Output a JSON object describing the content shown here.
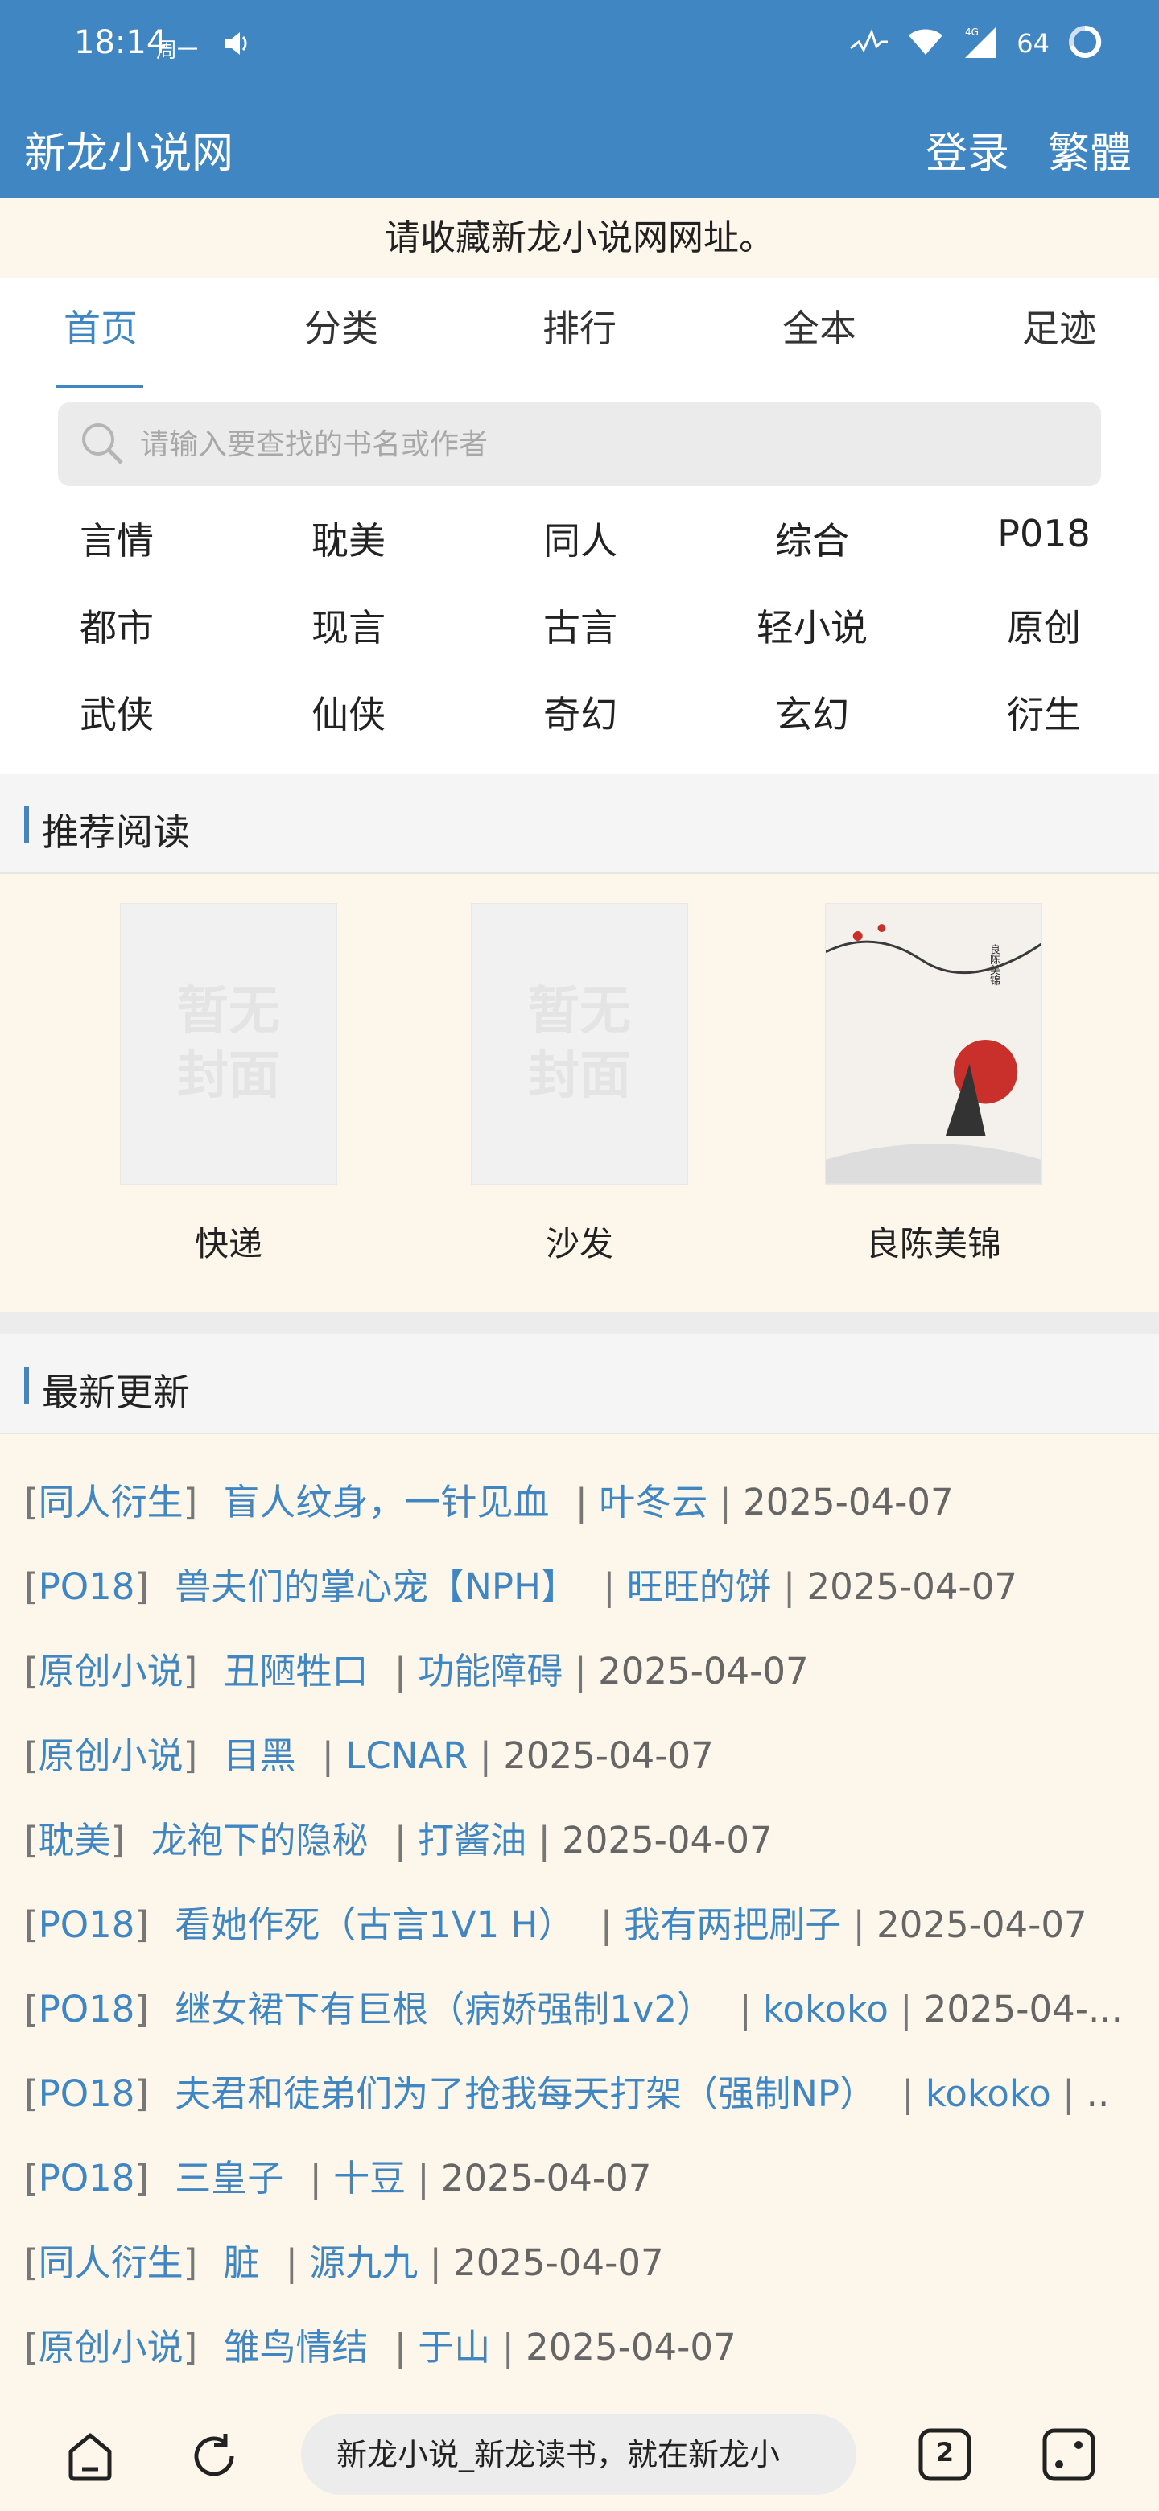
{
  "status_bar": {
    "time": "18:14",
    "weekday": "周一",
    "battery": "64"
  },
  "header": {
    "title": "新龙小说网",
    "login": "登录",
    "traditional": "繁體"
  },
  "notice": "请收藏新龙小说网网址。",
  "nav": {
    "tabs": [
      "首页",
      "分类",
      "排行",
      "全本",
      "足迹"
    ],
    "active": "首页"
  },
  "search": {
    "placeholder": "请输入要查找的书名或作者"
  },
  "categories": [
    [
      "言情",
      "耽美",
      "同人",
      "综合",
      "P018"
    ],
    [
      "都市",
      "现言",
      "古言",
      "轻小说",
      "原创"
    ],
    [
      "武侠",
      "仙侠",
      "奇幻",
      "玄幻",
      "衍生"
    ]
  ],
  "recommend": {
    "heading": "推荐阅读",
    "books": [
      {
        "title": "快递",
        "cover_text": "暂无封面"
      },
      {
        "title": "沙发",
        "cover_text": "暂无封面"
      },
      {
        "title": "良陈美锦",
        "cover_text": "良陈美锦"
      }
    ]
  },
  "latest": {
    "heading": "最新更新",
    "items": [
      {
        "cat": "同人衍生",
        "name": "盲人纹身，一针见血",
        "author": "叶冬云",
        "date": "2025-04-07"
      },
      {
        "cat": "PO18",
        "name": "兽夫们的掌心宠【NPH】",
        "author": "旺旺的饼",
        "date": "2025-04-07"
      },
      {
        "cat": "原创小说",
        "name": "丑陋牲口",
        "author": "功能障碍",
        "date": "2025-04-07"
      },
      {
        "cat": "原创小说",
        "name": "目黑",
        "author": "LCNAR",
        "date": "2025-04-07"
      },
      {
        "cat": "耽美",
        "name": "龙袍下的隐秘",
        "author": "打酱油",
        "date": "2025-04-07"
      },
      {
        "cat": "PO18",
        "name": "看她作死（古言1V1 H）",
        "author": "我有两把刷子",
        "date": "2025-04-07"
      },
      {
        "cat": "PO18",
        "name": "继女裙下有巨根（病娇强制1v2）",
        "author": "kokoko",
        "date": "2025-04-..."
      },
      {
        "cat": "PO18",
        "name": "夫君和徒弟们为了抢我每天打架（强制NP）",
        "author": "kokoko",
        "date": ".."
      },
      {
        "cat": "PO18",
        "name": "三皇子",
        "author": "十豆",
        "date": "2025-04-07"
      },
      {
        "cat": "同人衍生",
        "name": "脏",
        "author": "源九九",
        "date": "2025-04-07"
      },
      {
        "cat": "原创小说",
        "name": "雏鸟情结",
        "author": "于山",
        "date": "2025-04-07"
      }
    ]
  },
  "browser": {
    "url_text": "新龙小说_新龙读书，就在新龙小",
    "tab_count": "2"
  },
  "colors": {
    "accent": "#3f86c3",
    "page_bg": "#fdf6ea"
  }
}
